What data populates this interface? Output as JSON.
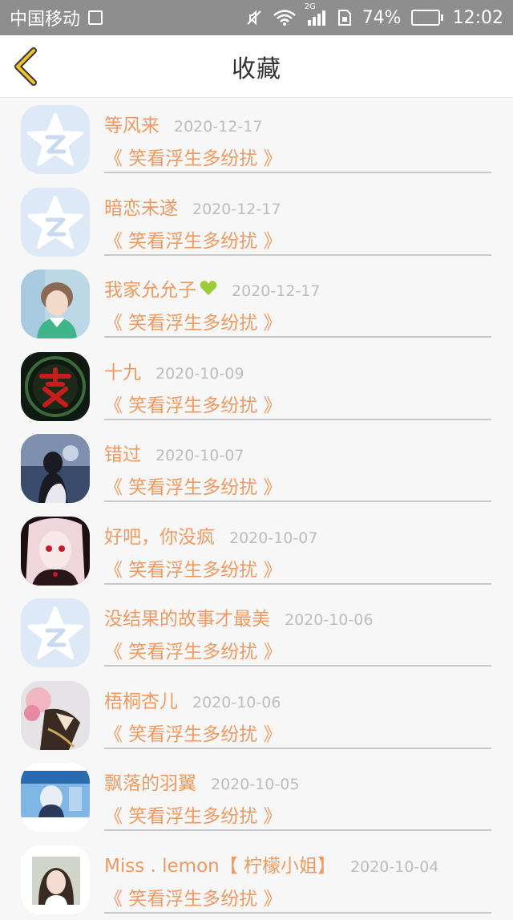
{
  "status_bar": {
    "carrier": "中国移动",
    "network_type": "2G",
    "battery_percent": "74%",
    "battery_level": 0.74,
    "time": "12:02",
    "icons": [
      "image-icon",
      "mute-icon",
      "wifi-icon",
      "signal-icon",
      "sim-icon",
      "battery-icon"
    ]
  },
  "nav": {
    "title": "收藏",
    "back_icon": "chevron-left-icon",
    "accent_color": "#f2c12e"
  },
  "colors": {
    "name_text": "#ef9a62",
    "date_text": "#bdbdbd",
    "heart": "#9ccc3a"
  },
  "items": [
    {
      "name": "等风来",
      "date": "2020-12-17",
      "work": "《 笑看浮生多纷扰 》",
      "avatar": "default-avatar"
    },
    {
      "name": "暗恋未遂",
      "date": "2020-12-17",
      "work": "《 笑看浮生多纷扰 》",
      "avatar": "default-avatar"
    },
    {
      "name": "我家允允子",
      "date": "2020-12-17",
      "work": "《 笑看浮生多纷扰 》",
      "avatar": "photo-avatar",
      "badge": "heart-icon"
    },
    {
      "name": "十九",
      "date": "2020-10-09",
      "work": "《 笑看浮生多纷扰 》",
      "avatar": "photo-avatar"
    },
    {
      "name": "错过",
      "date": "2020-10-07",
      "work": "《 笑看浮生多纷扰 》",
      "avatar": "photo-avatar"
    },
    {
      "name": "好吧，你没疯",
      "date": "2020-10-07",
      "work": "《 笑看浮生多纷扰 》",
      "avatar": "photo-avatar"
    },
    {
      "name": "没结果的故事才最美",
      "date": "2020-10-06",
      "work": "《 笑看浮生多纷扰 》",
      "avatar": "default-avatar"
    },
    {
      "name": "梧桐杏儿",
      "date": "2020-10-06",
      "work": "《 笑看浮生多纷扰 》",
      "avatar": "photo-avatar"
    },
    {
      "name": "飘落的羽翼",
      "date": "2020-10-05",
      "work": "《 笑看浮生多纷扰 》",
      "avatar": "photo-avatar"
    },
    {
      "name": "Miss . lemon【 柠檬小姐】",
      "date": "2020-10-04",
      "work": "《 笑看浮生多纷扰 》",
      "avatar": "photo-avatar"
    }
  ]
}
